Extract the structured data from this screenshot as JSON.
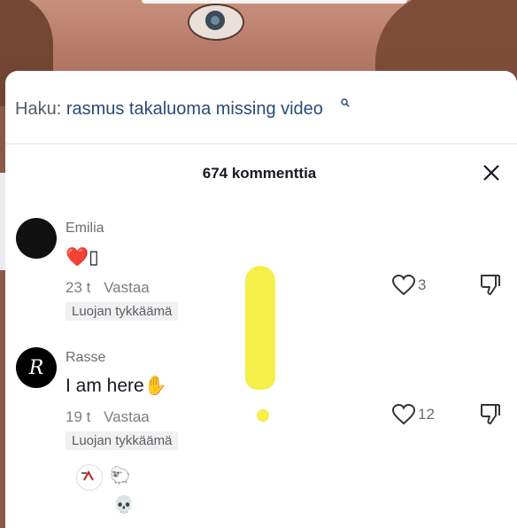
{
  "search": {
    "prefix": "Haku:",
    "query": "rasmus takaluoma missing video"
  },
  "header": {
    "count_label": "674 kommenttia"
  },
  "comments": [
    {
      "username": "Emilia",
      "text": "❤️▯",
      "time": "23 t",
      "reply_label": "Vastaa",
      "badge": "Luojan tykkäämä",
      "likes": "3"
    },
    {
      "username": "Rasse",
      "avatar_letter": "R",
      "text": "I am here✋",
      "time": "19 t",
      "reply_label": "Vastaa",
      "badge": "Luojan tykkäämä",
      "likes": "12"
    }
  ],
  "reply_avatars": [
    "🐑",
    "💀"
  ],
  "colors": {
    "accent": "#2b4a7a",
    "highlight": "#f5ef4a",
    "text": "#161823"
  }
}
